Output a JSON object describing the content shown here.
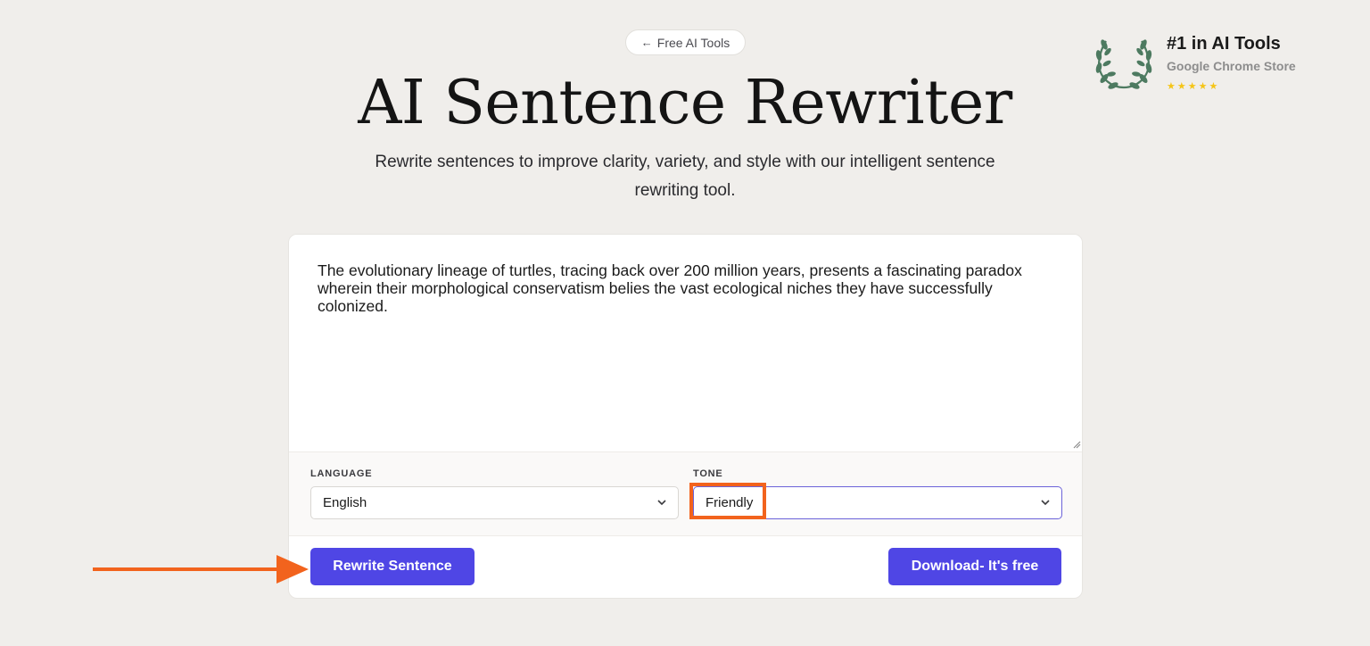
{
  "nav": {
    "back_arrow": "←",
    "back_label": "Free AI Tools"
  },
  "hero": {
    "title": "AI Sentence Rewriter",
    "subtitle": "Rewrite sentences to improve clarity, variety, and style with our intelligent sentence rewriting tool."
  },
  "badge": {
    "title": "#1 in AI Tools",
    "subtitle": "Google Chrome Store",
    "stars": "★★★★★",
    "rating": 5,
    "laurel_color": "#4d7a60",
    "star_color": "#f5c518"
  },
  "editor": {
    "text": "The evolutionary lineage of turtles, tracing back over 200 million years, presents a fascinating paradox wherein their morphological conservatism belies the vast ecological niches they have successfully colonized."
  },
  "options": {
    "language_label": "LANGUAGE",
    "language_value": "English",
    "tone_label": "TONE",
    "tone_value": "Friendly"
  },
  "actions": {
    "rewrite_label": "Rewrite Sentence",
    "download_label": "Download- It's free"
  },
  "colors": {
    "accent": "#4f46e5",
    "annotation": "#f2631d",
    "background": "#f0eeeb"
  }
}
